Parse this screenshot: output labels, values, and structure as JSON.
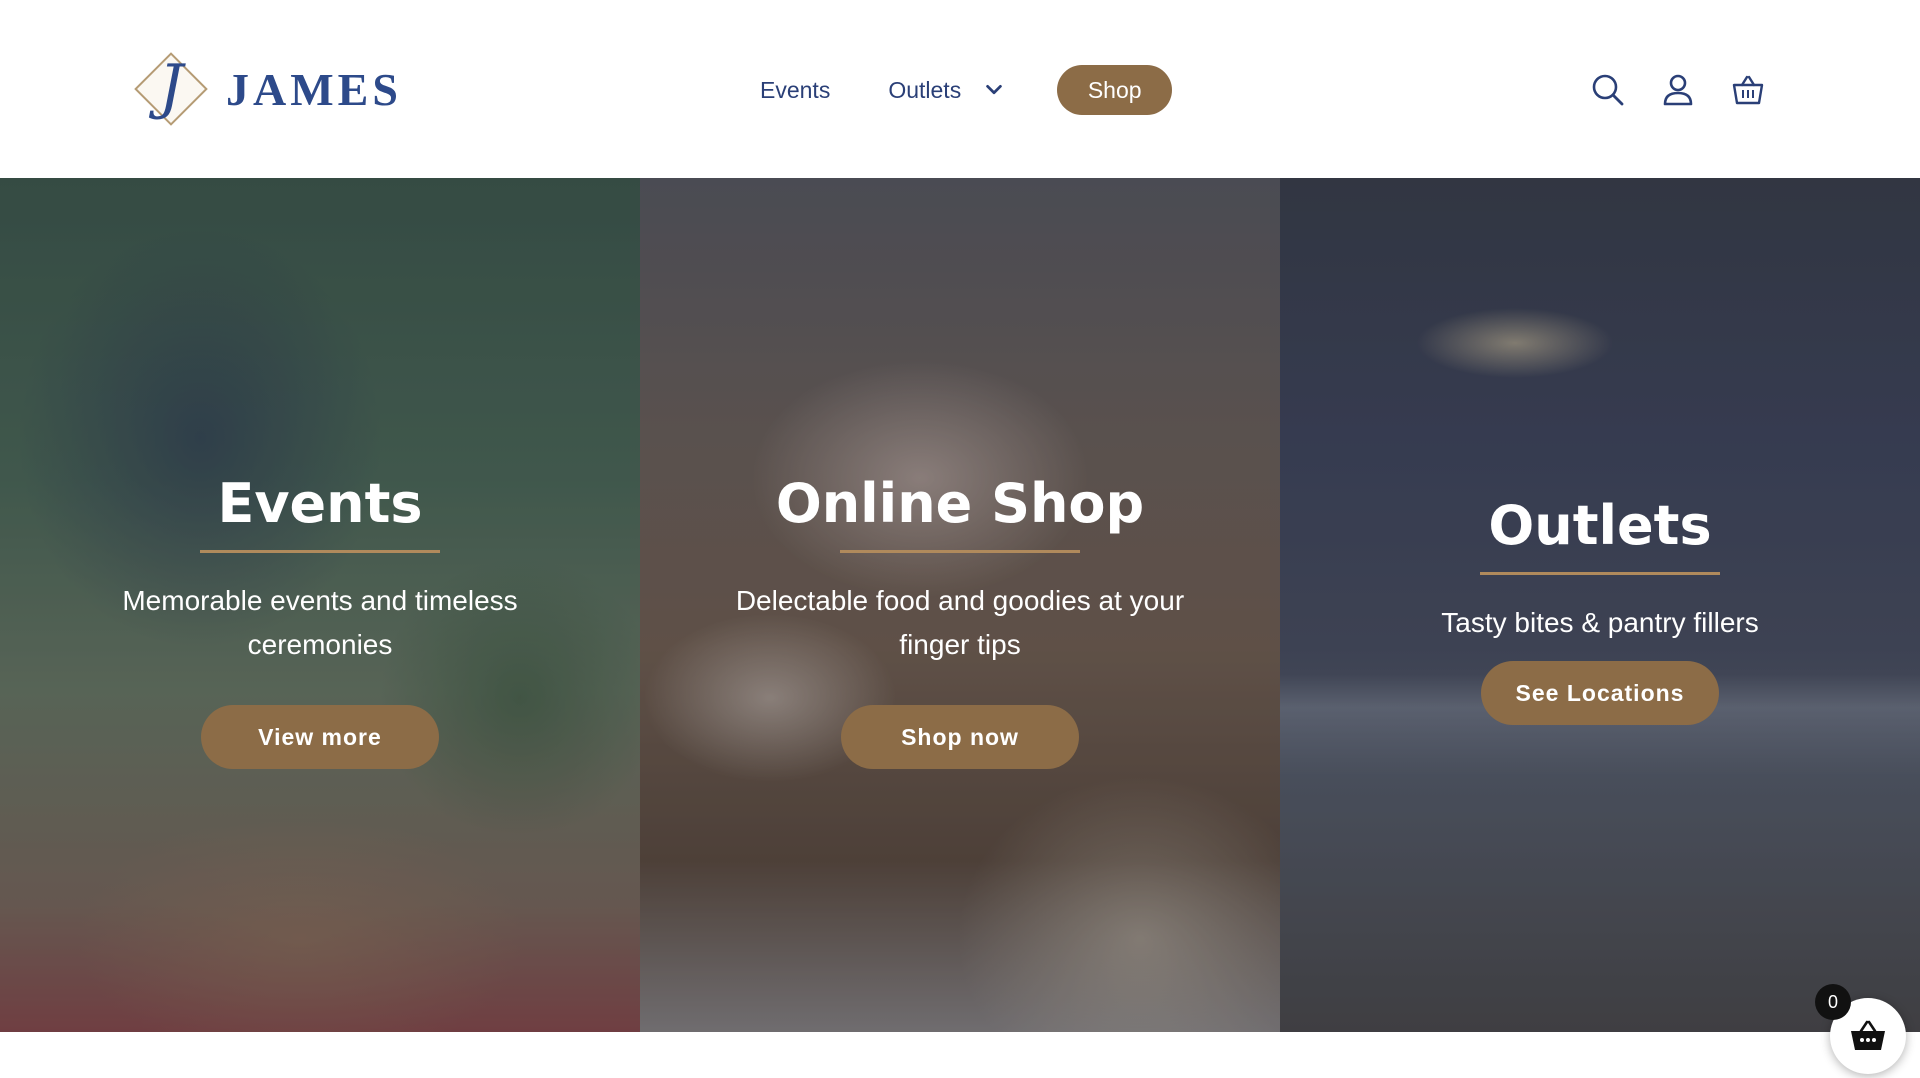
{
  "brand": {
    "name": "JAMES",
    "logo_letter": "J"
  },
  "nav": {
    "events_label": "Events",
    "outlets_label": "Outlets",
    "shop_label": "Shop"
  },
  "header_icons": [
    "search-icon",
    "user-icon",
    "basket-icon"
  ],
  "panels": [
    {
      "title": "Events",
      "description": "Memorable events and timeless ceremonies",
      "button_label": "View more"
    },
    {
      "title": "Online Shop",
      "description": "Delectable food and goodies at your finger tips",
      "button_label": "Shop now"
    },
    {
      "title": "Outlets",
      "description": "Tasty bites & pantry fillers",
      "button_label": "See Locations"
    }
  ],
  "cart": {
    "count": "0"
  },
  "colors": {
    "brand_blue": "#2d4a8a",
    "accent_brown": "#8c6c47",
    "divider_gold": "#b08a5c"
  }
}
